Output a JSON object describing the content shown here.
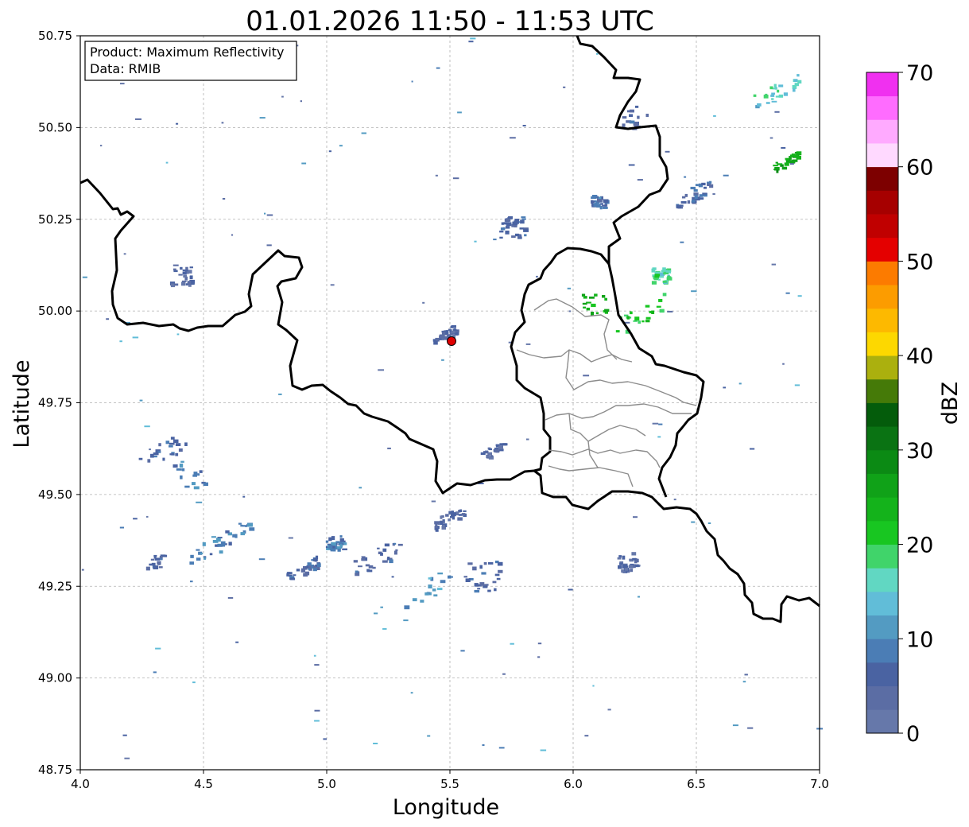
{
  "title": "01.01.2026 11:50 - 11:53 UTC",
  "info_box": {
    "product_line": "Product: Maximum Reflectivity",
    "data_line": "Data: RMIB"
  },
  "chart_data": {
    "type": "heatmap",
    "title": "01.01.2026 11:50 - 11:53 UTC",
    "xlabel": "Longitude",
    "ylabel": "Latitude",
    "xlim": [
      4.0,
      7.0
    ],
    "ylim": [
      48.75,
      50.75
    ],
    "xticks": [
      "4.0",
      "4.5",
      "5.0",
      "5.5",
      "6.0",
      "6.5",
      "7.0"
    ],
    "yticks": [
      "48.75",
      "49.00",
      "49.25",
      "49.50",
      "49.75",
      "50.00",
      "50.25",
      "50.50",
      "50.75"
    ],
    "grid": true,
    "radar_site": {
      "lon": 5.505,
      "lat": 49.915
    },
    "colorbar": {
      "label": "dBZ",
      "min": 0,
      "max": 70,
      "step": 2.5,
      "ticks": [
        "0",
        "10",
        "20",
        "30",
        "40",
        "50",
        "60",
        "70"
      ],
      "colors": [
        "#6678aa",
        "#5b6da4",
        "#4a63a2",
        "#4b7db5",
        "#539bc2",
        "#61bdd8",
        "#61d7c2",
        "#40d46a",
        "#18c621",
        "#14b31b",
        "#10a218",
        "#0b8a14",
        "#0a7313",
        "#045c0b",
        "#457a08",
        "#abb00e",
        "#fdd800",
        "#fdb900",
        "#fc9c00",
        "#fc7b00",
        "#e40000",
        "#c00000",
        "#a60000",
        "#7d0000",
        "#ffd9ff",
        "#ffaaff",
        "#ff6cff",
        "#f030f0"
      ]
    },
    "echo_areas": [
      {
        "lon": 4.33,
        "lat": 49.62,
        "intensity_dbz": 7
      },
      {
        "lon": 4.43,
        "lat": 49.55,
        "intensity_dbz": 10
      },
      {
        "lon": 4.52,
        "lat": 49.36,
        "intensity_dbz": 9
      },
      {
        "lon": 4.62,
        "lat": 49.4,
        "intensity_dbz": 10
      },
      {
        "lon": 4.3,
        "lat": 49.32,
        "intensity_dbz": 6
      },
      {
        "lon": 5.03,
        "lat": 49.37,
        "intensity_dbz": 9
      },
      {
        "lon": 4.9,
        "lat": 49.3,
        "intensity_dbz": 7
      },
      {
        "lon": 5.2,
        "lat": 49.33,
        "intensity_dbz": 6
      },
      {
        "lon": 5.42,
        "lat": 49.25,
        "intensity_dbz": 11
      },
      {
        "lon": 5.63,
        "lat": 49.28,
        "intensity_dbz": 6
      },
      {
        "lon": 5.5,
        "lat": 49.44,
        "intensity_dbz": 5
      },
      {
        "lon": 6.22,
        "lat": 49.32,
        "intensity_dbz": 5
      },
      {
        "lon": 5.67,
        "lat": 49.62,
        "intensity_dbz": 5
      },
      {
        "lon": 6.1,
        "lat": 50.3,
        "intensity_dbz": 8
      },
      {
        "lon": 5.75,
        "lat": 50.23,
        "intensity_dbz": 6
      },
      {
        "lon": 6.08,
        "lat": 50.02,
        "intensity_dbz": 24
      },
      {
        "lon": 6.27,
        "lat": 49.99,
        "intensity_dbz": 22
      },
      {
        "lon": 6.35,
        "lat": 50.1,
        "intensity_dbz": 18
      },
      {
        "lon": 6.86,
        "lat": 50.41,
        "intensity_dbz": 26
      },
      {
        "lon": 6.48,
        "lat": 50.32,
        "intensity_dbz": 7
      },
      {
        "lon": 5.48,
        "lat": 49.94,
        "intensity_dbz": 5
      },
      {
        "lon": 4.4,
        "lat": 50.1,
        "intensity_dbz": 5
      },
      {
        "lon": 6.82,
        "lat": 50.6,
        "intensity_dbz": 16
      },
      {
        "lon": 6.25,
        "lat": 50.53,
        "intensity_dbz": 6
      }
    ]
  }
}
